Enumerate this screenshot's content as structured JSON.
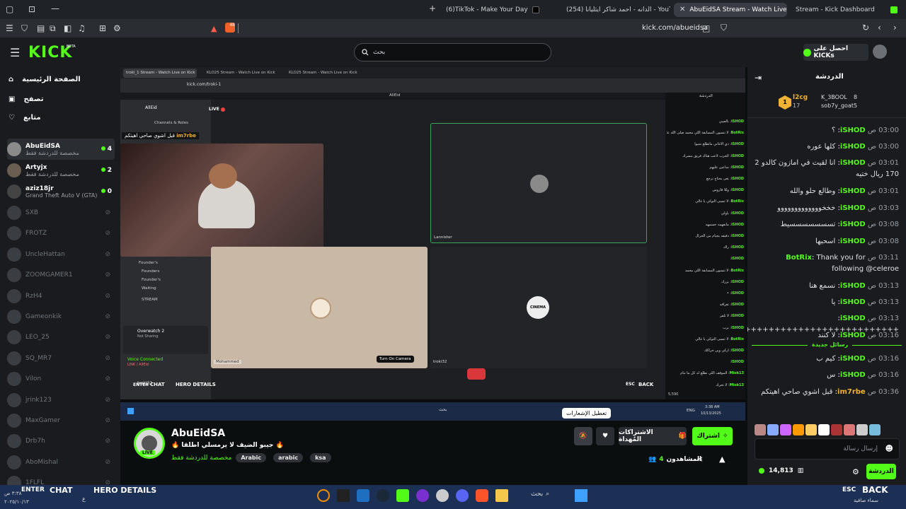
{
  "browser": {
    "tabs": [
      {
        "label": "(6)TikTok - Make Your Day"
      },
      {
        "label": "(254) الدانه - احمد شاكر ايثليانا - YouTube"
      },
      {
        "label": "AbuEidSA Stream - Watch Live on Kick"
      },
      {
        "label": "Stream - Kick Dashboard"
      }
    ],
    "new_tab": "+",
    "url": "kick.com/abueidsa",
    "ext_badge": "48"
  },
  "header": {
    "logo": "KICK",
    "logo_beta": "BETA",
    "search_placeholder": "بحث",
    "get_kicks": "احصل على KICKs"
  },
  "sidebar": {
    "nav": [
      {
        "label": "الصفحة الرئيسية",
        "icon": "home-icon"
      },
      {
        "label": "تصفح",
        "icon": "browse-icon"
      },
      {
        "label": "متابع",
        "icon": "heart-icon"
      }
    ],
    "channels_live": [
      {
        "name": "AbuEidSA",
        "sub": "مخصصة للدردشة فقط",
        "count": "4"
      },
      {
        "name": "Artyjx",
        "sub": "مخصصة للدردشة فقط",
        "count": "2"
      },
      {
        "name": "aziz18jr",
        "sub": "Grand Theft Auto V (GTA)",
        "count": "0"
      }
    ],
    "channels_offline": [
      "SXB",
      "FROTZ",
      "UncleHattan",
      "ZOOMGAMER1",
      "RzH4",
      "Gameonkik",
      "LEO_25",
      "SQ_MR7",
      "Vilon",
      "jrink123",
      "MaxGamer",
      "Drb7h",
      "AboMishal",
      "1FLFL"
    ]
  },
  "stream": {
    "inner_tabs": [
      "troki_1 Stream - Watch Live on Kick",
      "KLO25 Stream - Watch Live on Kick",
      "KLO25 Stream - Watch Live on Kick"
    ],
    "inner_url": "kick.com/troki-1",
    "discord_title": "AllEid",
    "live_label": "LIVE",
    "channels_roles": "Channels & Roles",
    "overlay_user": "im7rbe",
    "overlay_text": "قبل اشوي صاحي اهيتكم",
    "tile_names": [
      "Mohammed",
      "Lannister",
      "troki32"
    ],
    "channel_list": [
      "Founder's",
      "Founders",
      "Founder's",
      "Waiting",
      "STREAM"
    ],
    "voice_game": "Overwatch 2",
    "voice_sub": "Not Sharing",
    "voice_connected": "Voice Connected",
    "voice_server": "LINK / AllEid",
    "user_tag": "troki32",
    "turn_on_camera": "Turn On Camera",
    "pip": "CINEMA",
    "overlay_enter": "ENTER",
    "overlay_chat": "CHAT",
    "overlay_hero": "HERO DETAILS",
    "overlay_esc": "ESC",
    "overlay_back": "BACK",
    "inner_time": "3:38 AM",
    "inner_date": "10/13/2025",
    "inner_search": "بحث",
    "inner_lang": "ENG",
    "inner_viewers": "5,590",
    "inner_chat_header": "الدردشة",
    "inner_chat": [
      {
        "u": "iSHOD",
        "t": "بالعيبي"
      },
      {
        "u": "BotRix",
        "t": "لا تنسون المسابقة اللي محمد صلى الله عليه وسلم"
      },
      {
        "u": "iSHOD",
        "t": "ذي الاغاني ماتطلع شيوا"
      },
      {
        "u": "iSHOD",
        "t": "الحرب لاعب هناك فريق ينسرك"
      },
      {
        "u": "iSHOD",
        "t": "ساعين عليهم"
      },
      {
        "u": "iSHOD",
        "t": "بغى يحتاج نرجع"
      },
      {
        "u": "iSHOD",
        "t": "وللا قاروس"
      },
      {
        "u": "BotRix",
        "t": "لا تنسى التوكي يا غالي"
      },
      {
        "u": "iSHOD",
        "t": "ياولي"
      },
      {
        "u": "iSHOD",
        "t": "مانفهمه جسمهه"
      },
      {
        "u": "iSHOD",
        "t": "دقيقه يجيام من الحرال"
      },
      {
        "u": "iSHOD",
        "t": "راك"
      },
      {
        "u": "iSHOD",
        "t": ""
      },
      {
        "u": "BotRix",
        "t": "لا تنسون المسابقة اللي محمد"
      },
      {
        "u": "iSHOD",
        "t": "بزرك"
      },
      {
        "u": "iSHOD",
        "t": "•"
      },
      {
        "u": "iSHOD",
        "t": "تعرافه"
      },
      {
        "u": "iSHOD",
        "t": "لا تلفر"
      },
      {
        "u": "iSHOD",
        "t": "برب"
      },
      {
        "u": "BotRix",
        "t": "لا تنسى التوكي يا غالي"
      },
      {
        "u": "iSHOD",
        "t": "اركي وين حراكك"
      },
      {
        "u": "iSHOD",
        "t": ""
      },
      {
        "u": "Miok13",
        "t": "الموقف اللي تطلع له كل ما تنام"
      },
      {
        "u": "Miok13",
        "t": "لا تحرك"
      }
    ]
  },
  "info": {
    "streamer": "AbuEidSA",
    "live_badge": "LIVE",
    "title": "جيبو الضيف لا يرمسلي اطلقا",
    "category": "مخصصة للدردشة فقط",
    "tags": [
      "Arabic",
      "arabic",
      "ksa"
    ],
    "follow": "اشتراك",
    "gift_subs": "الاشتراكات المُهداة",
    "tooltip": "تعطيل الإشعارات",
    "viewers_label": "المشاهدون",
    "viewers": "4"
  },
  "chat": {
    "title": "الدردشة",
    "leaders": [
      {
        "rank": "1",
        "name": "l2cg",
        "count": "17"
      },
      {
        "rank": "",
        "name": "K_3BOOL",
        "count": "8"
      },
      {
        "rank": "",
        "name": "sob7y_goat",
        "count": "5"
      }
    ],
    "messages": [
      {
        "time": "03:00",
        "ampm": "ص",
        "u": "iSHOD",
        "t": "؟"
      },
      {
        "time": "03:00",
        "ampm": "ص",
        "u": "iSHOD",
        "t": "كلها عوره"
      },
      {
        "time": "03:01",
        "ampm": "ص",
        "u": "iSHOD",
        "t": "انا لقيت في امازون كالدو 2 170 ريال ختيه"
      },
      {
        "time": "03:01",
        "ampm": "ص",
        "u": "iSHOD",
        "t": "وطالع حلو والله"
      },
      {
        "time": "03:03",
        "ampm": "ص",
        "u": "iSHOD",
        "t": "خخخووووووووووووو"
      },
      {
        "time": "03:08",
        "ampm": "ص",
        "u": "iSHOD",
        "t": "تسسسسسسسيط"
      },
      {
        "time": "03:08",
        "ampm": "ص",
        "u": "iSHOD",
        "t": "اسحبها"
      },
      {
        "time": "03:11",
        "ampm": "ص",
        "u": "BotRix",
        "t": "Thank you for following @celeroe"
      },
      {
        "time": "03:13",
        "ampm": "ص",
        "u": "iSHOD",
        "t": "نسمع هنا"
      },
      {
        "time": "03:13",
        "ampm": "ص",
        "u": "iSHOD",
        "t": "يا"
      },
      {
        "time": "03:13",
        "ampm": "ص",
        "u": "iSHOD",
        "t": "++++++++++++++++++++++++++"
      },
      {
        "time": "03:16",
        "ampm": "ص",
        "u": "iSHOD",
        "t": "لا كنند"
      },
      {
        "time": "03:16",
        "ampm": "ص",
        "u": "iSHOD",
        "t": "كيم ب"
      },
      {
        "time": "03:16",
        "ampm": "ص",
        "u": "iSHOD",
        "t": "س"
      },
      {
        "time": "03:36",
        "ampm": "ص",
        "u": "im7rbe",
        "t": "قبل اشوي صاحي اهيتكم"
      }
    ],
    "new_messages": "رسائل جديدة",
    "input_placeholder": "إرسال رسالة",
    "send": "الدردشة",
    "points": "14,813"
  },
  "taskbar": {
    "enter": "ENTER",
    "chat": "CHAT",
    "hero": "HERO DETAILS",
    "esc": "ESC",
    "back": "BACK",
    "search": "بحث",
    "weather": "سماء صافية",
    "time": "٣:٣٨ ص",
    "date": "٢٠٢٥/١٠/١٣",
    "lang": "ع"
  },
  "colors": {
    "kick_green": "#53fc18",
    "bg": "#0b0e0f",
    "panel": "#191b1f"
  }
}
